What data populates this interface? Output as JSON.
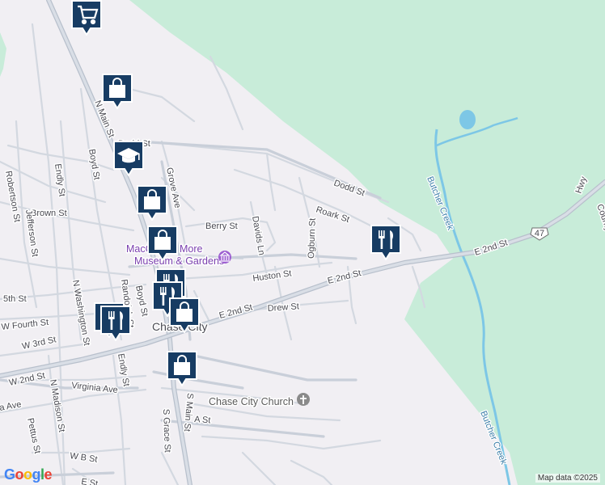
{
  "map": {
    "attribution": "Map data ©2025",
    "logo_text": "Google",
    "logo_colors": [
      "#4285F4",
      "#EA4335",
      "#FBBC05",
      "#4285F4",
      "#34A853",
      "#EA4335"
    ],
    "colors": {
      "background": "#f1eff3",
      "park": "#c8ecd9",
      "water": "#7dc7e6",
      "road": "#c9cfd9",
      "marker": "#173c63"
    },
    "labels": {
      "town": "Chase City",
      "museum": "MacCallum More Museum & Gardens",
      "museum_line1": "MacCallum More",
      "museum_line2": "Museum & Gardens",
      "church": "Chase City Church",
      "creek_1": "Butcher Creek",
      "creek_2": "Butcher Creek",
      "highway_shield": "47",
      "hwy_partial": "Hwy",
      "county_partial": "County"
    },
    "streets": {
      "n_main": "N Main St",
      "boyd_n": "Boyd St",
      "dodd_w": "Dodd St",
      "dodd_e": "Dodd St",
      "endly_n": "Endly St",
      "robertson": "Robertson St",
      "brown": "Brown St",
      "jefferson": "Jefferson St",
      "grove": "Grove Ave",
      "berry": "Berry St",
      "davids": "Davids Ln",
      "ogburn": "Ogburn St",
      "roark": "Roark St",
      "e2nd_right": "E 2nd St",
      "e2nd_mid": "E 2nd St",
      "e2nd_left": "E 2nd St",
      "huston": "Huston St",
      "drew": "Drew St",
      "fifth": "5th St",
      "w_fourth": "W Fourth St",
      "n_washington": "N Washington St",
      "randolph": "Randolph St",
      "boyd_s": "Boyd St",
      "w3rd": "W 3rd St",
      "w2nd": "W 2nd St",
      "endly_s": "Endly St",
      "n_madison": "N Madison St",
      "virginia": "Virginia Ave",
      "ave_partial": "a Ave",
      "pettus": "Pettus St",
      "s_main": "S Main St",
      "s_grace": "S Grace St",
      "a_st": "A St",
      "w_b": "W B St",
      "e_st": "E St"
    },
    "markers": [
      {
        "icon": "shopping-cart"
      },
      {
        "icon": "shopping-bag"
      },
      {
        "icon": "school"
      },
      {
        "icon": "shopping-bag"
      },
      {
        "icon": "shopping-bag"
      },
      {
        "icon": "restaurant"
      },
      {
        "icon": "restaurant"
      },
      {
        "icon": "restaurant"
      },
      {
        "icon": "restaurant"
      },
      {
        "icon": "restaurant"
      },
      {
        "icon": "shopping-bag"
      },
      {
        "icon": "shopping-bag"
      }
    ]
  }
}
